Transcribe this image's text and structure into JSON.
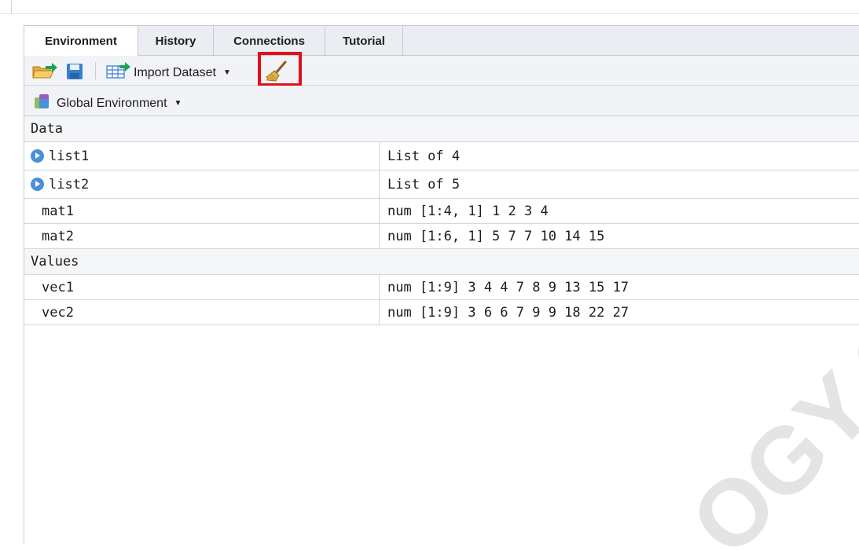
{
  "tabs": [
    {
      "label": "Environment",
      "active": true
    },
    {
      "label": "History",
      "active": false
    },
    {
      "label": "Connections",
      "active": false
    },
    {
      "label": "Tutorial",
      "active": false
    }
  ],
  "toolbar": {
    "open_icon": "folder-open-icon",
    "save_icon": "save-icon",
    "import_icon": "import-table-icon",
    "import_label": "Import Dataset",
    "broom_icon": "broom-icon",
    "highlight_color": "#e3101a"
  },
  "environment": {
    "icon": "environment-cubes-icon",
    "label": "Global Environment"
  },
  "sections": {
    "data": "Data",
    "values": "Values"
  },
  "data_rows": [
    {
      "name": "list1",
      "value": "List of 4",
      "expandable": true
    },
    {
      "name": "list2",
      "value": "List of 5",
      "expandable": true
    },
    {
      "name": "mat1",
      "value": "num [1:4, 1] 1 2 3 4",
      "expandable": false
    },
    {
      "name": "mat2",
      "value": "num [1:6, 1] 5 7 7 10 14 15",
      "expandable": false
    }
  ],
  "value_rows": [
    {
      "name": "vec1",
      "value": "num [1:9] 3 4 4 7 8 9 13 15 17"
    },
    {
      "name": "vec2",
      "value": "num [1:9] 3 6 6 7 9 9 18 22 27"
    }
  ],
  "watermark_text": "OGY.CO"
}
